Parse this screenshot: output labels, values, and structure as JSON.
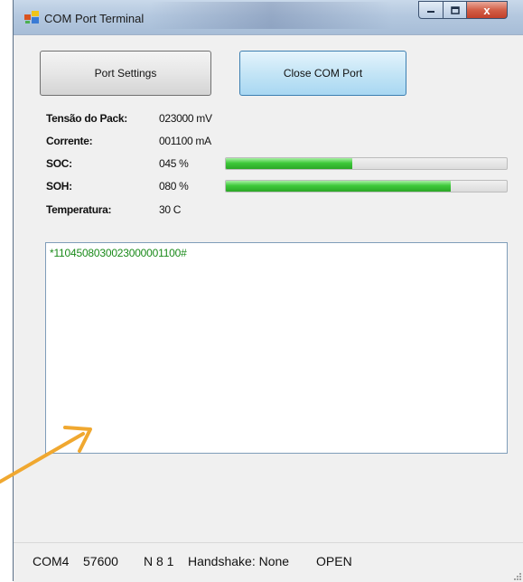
{
  "window": {
    "title": "COM Port Terminal",
    "close_glyph": "x"
  },
  "buttons": {
    "port_settings": "Port Settings",
    "close_com_port": "Close COM Port"
  },
  "readings": [
    {
      "label": "Tensão do Pack:",
      "value": "023000 mV"
    },
    {
      "label": "Corrente:",
      "value": "001100 mA"
    },
    {
      "label": "SOC:",
      "value": "045 %",
      "level_percent": 45
    },
    {
      "label": "SOH:",
      "value": "080 %",
      "level_percent": 80
    },
    {
      "label": "Temperatura:",
      "value": "30 C"
    }
  ],
  "terminal": {
    "text": "*110450803002300000110​0#"
  },
  "status": {
    "port": "COM4",
    "baud": "57600",
    "framing": "N 8 1",
    "handshake": "Handshake: None",
    "state": "OPEN"
  },
  "colors": {
    "progress_fill": "#3ec93a",
    "terminal_text": "#1a8a1a",
    "arrow": "#f0a830"
  },
  "icons": {
    "app": "app-window-icon",
    "minimize": "minimize-icon",
    "maximize": "maximize-icon",
    "close": "close-icon",
    "arrow": "arrow-annotation-icon"
  }
}
